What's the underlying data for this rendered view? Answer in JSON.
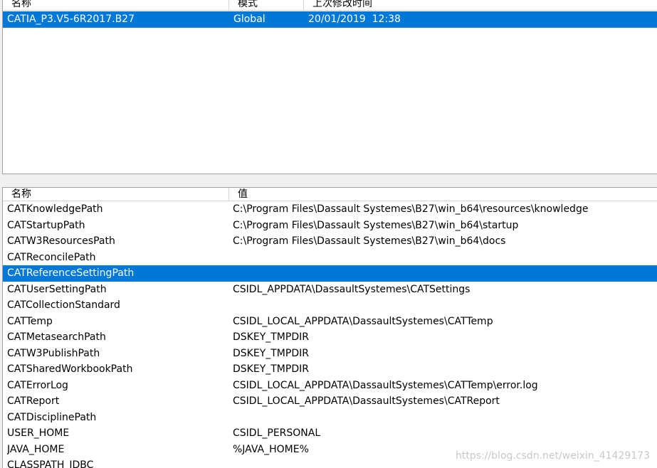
{
  "env_list": {
    "columns": [
      "名称",
      "模式",
      "上次修改时间"
    ],
    "rows": [
      {
        "name": "CATIA_P3.V5-6R2017.B27",
        "mode": "Global",
        "modified": "20/01/2019  12:38",
        "selected": true
      }
    ]
  },
  "var_list": {
    "columns": [
      "名称",
      "值"
    ],
    "rows": [
      {
        "name": "CATKnowledgePath",
        "value": "C:\\Program Files\\Dassault Systemes\\B27\\win_b64\\resources\\knowledge"
      },
      {
        "name": "CATStartupPath",
        "value": "C:\\Program Files\\Dassault Systemes\\B27\\win_b64\\startup"
      },
      {
        "name": "CATW3ResourcesPath",
        "value": "C:\\Program Files\\Dassault Systemes\\B27\\win_b64\\docs"
      },
      {
        "name": "CATReconcilePath",
        "value": ""
      },
      {
        "name": "CATReferenceSettingPath",
        "value": "",
        "selected": true
      },
      {
        "name": "CATUserSettingPath",
        "value": "CSIDL_APPDATA\\DassaultSystemes\\CATSettings"
      },
      {
        "name": "CATCollectionStandard",
        "value": ""
      },
      {
        "name": "CATTemp",
        "value": "CSIDL_LOCAL_APPDATA\\DassaultSystemes\\CATTemp"
      },
      {
        "name": "CATMetasearchPath",
        "value": "DSKEY_TMPDIR"
      },
      {
        "name": "CATW3PublishPath",
        "value": "DSKEY_TMPDIR"
      },
      {
        "name": "CATSharedWorkbookPath",
        "value": "DSKEY_TMPDIR"
      },
      {
        "name": "CATErrorLog",
        "value": "CSIDL_LOCAL_APPDATA\\DassaultSystemes\\CATTemp\\error.log"
      },
      {
        "name": "CATReport",
        "value": "CSIDL_LOCAL_APPDATA\\DassaultSystemes\\CATReport"
      },
      {
        "name": "CATDisciplinePath",
        "value": ""
      },
      {
        "name": "USER_HOME",
        "value": "CSIDL_PERSONAL"
      },
      {
        "name": "JAVA_HOME",
        "value": "%JAVA_HOME%"
      },
      {
        "name": "CLASSPATH_JDBC",
        "value": ""
      }
    ]
  },
  "watermark": "https://blog.csdn.net/weixin_41429173",
  "colors": {
    "selection": "#0078d7",
    "selection_text": "#ffffff"
  }
}
